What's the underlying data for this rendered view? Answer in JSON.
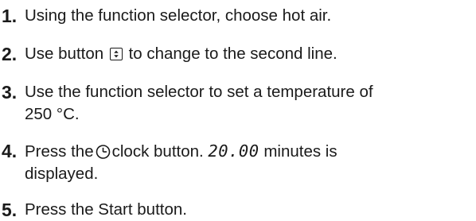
{
  "steps": [
    {
      "number": "1.",
      "text": "Using the function selector, choose hot air."
    },
    {
      "number": "2.",
      "before": "Use button",
      "icon": "scroll-up-down-button-icon",
      "after": "to change to the second line."
    },
    {
      "number": "3.",
      "line1": "Use the function selector to set a temperature of",
      "line2": "250 °C."
    },
    {
      "number": "4.",
      "before": "Press the",
      "icon": "clock-icon",
      "middle": "clock button.",
      "display": "20.00",
      "after": "minutes is",
      "line2": "displayed."
    },
    {
      "number": "5.",
      "text": "Press the Start button."
    }
  ]
}
